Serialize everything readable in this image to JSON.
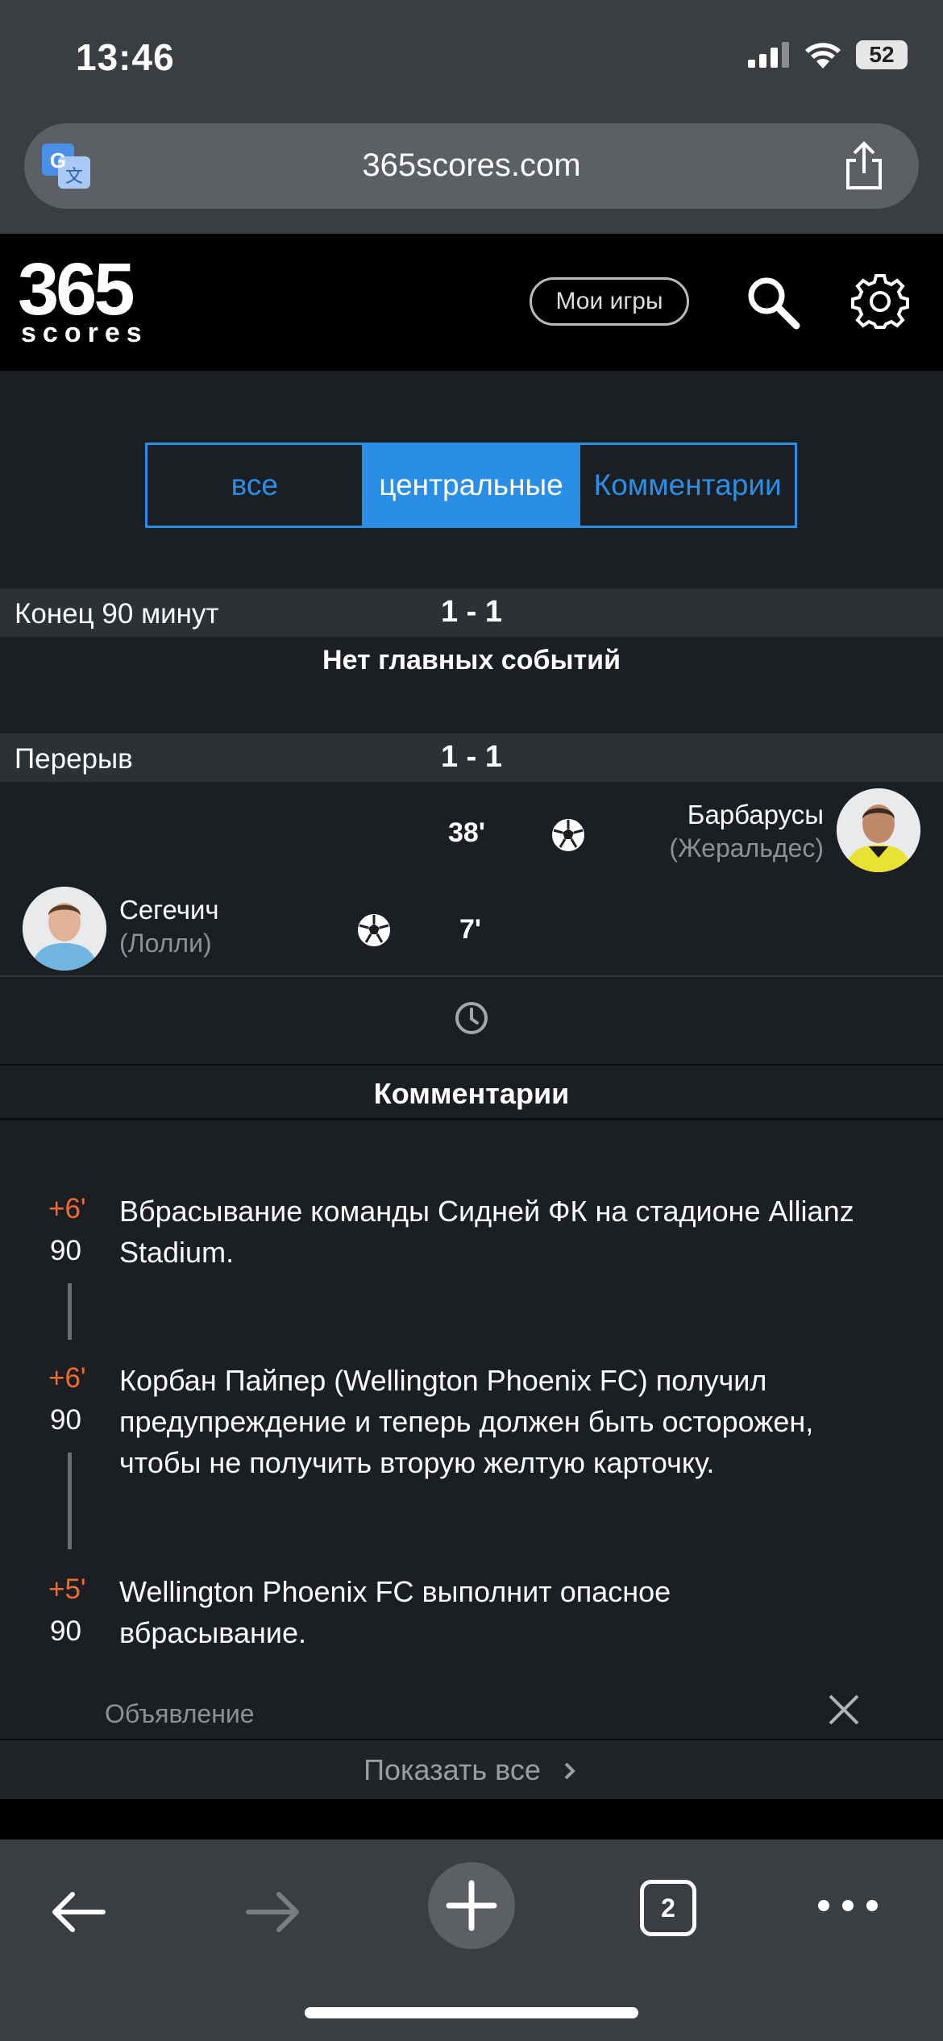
{
  "status_bar": {
    "time": "13:46",
    "battery": "52"
  },
  "browser": {
    "url": "365scores.com"
  },
  "site": {
    "logo_number": "365",
    "logo_word": "scores",
    "my_games_label": "Мои игры"
  },
  "tabs": [
    {
      "label": "все"
    },
    {
      "label": "центральные"
    },
    {
      "label": "Комментарии"
    }
  ],
  "periods": [
    {
      "label": "Конец 90 минут",
      "score": "1 - 1"
    },
    {
      "label": "Перерыв",
      "score": "1 - 1"
    }
  ],
  "no_events_text": "Нет главных событий",
  "events": [
    {
      "minute": "38'",
      "player": "Барбарусы",
      "assist": "(Жеральдес)",
      "side": "away"
    },
    {
      "minute": "7'",
      "player": "Сегечич",
      "assist": "(Лолли)",
      "side": "home"
    }
  ],
  "commentary": {
    "title": "Комментарии",
    "items": [
      {
        "extra": "+6'",
        "base": "90",
        "text": "Вбрасывание команды Сидней ФК на стадионе Allianz Stadium."
      },
      {
        "extra": "+6'",
        "base": "90",
        "text": "Корбан Пайпер (Wellington Phoenix FC) получил предупреждение и теперь должен быть осторожен, чтобы не получить вторую желтую карточку."
      },
      {
        "extra": "+5'",
        "base": "90",
        "text": "Wellington Phoenix FC выполнит опасное вбрасывание."
      }
    ],
    "ad_label": "Объявление",
    "show_all_label": "Показать все"
  },
  "toolbar": {
    "tab_count": "2"
  },
  "colors": {
    "accent": "#2a8ee6",
    "extra_time": "#f26a2d",
    "background": "#1b1f24"
  }
}
